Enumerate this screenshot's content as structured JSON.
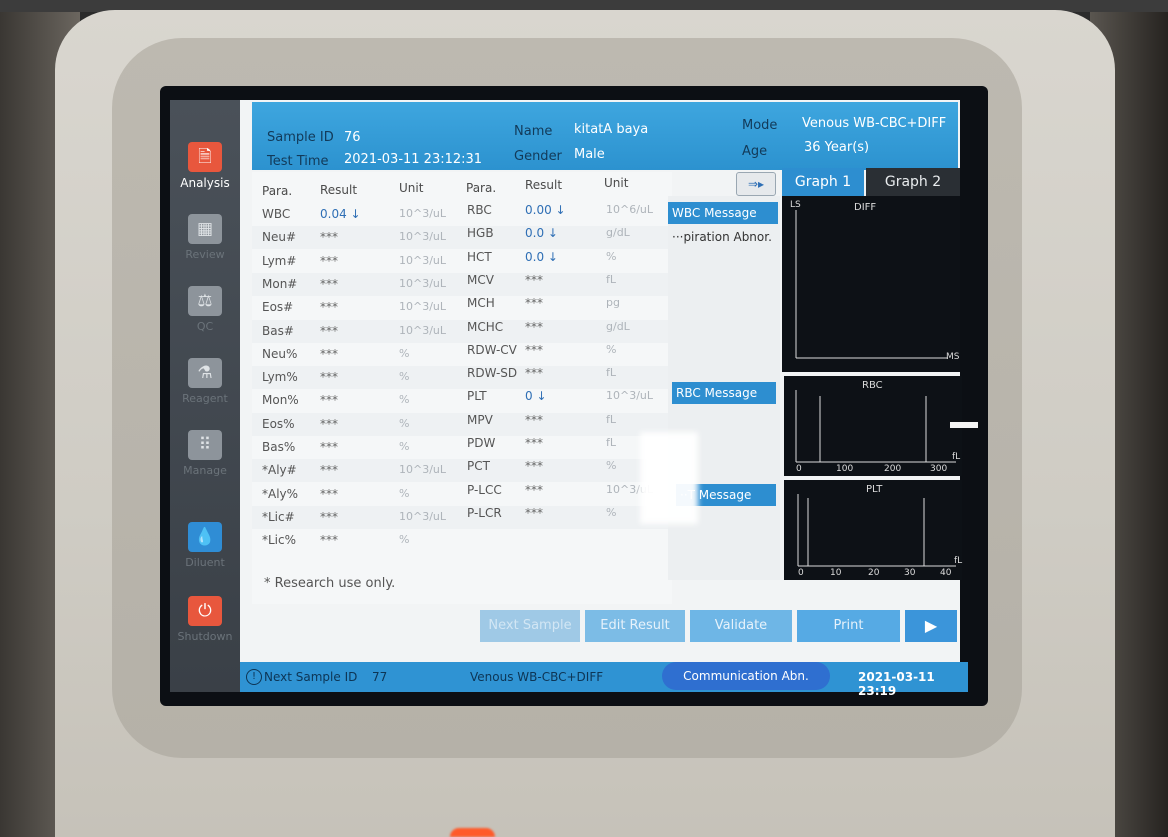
{
  "colors": {
    "header_blue": "#3ea6df",
    "accent_red": "#e8573d",
    "button_blue": "#5aaee6",
    "footer_pill": "#2f6fd0"
  },
  "sidebar": {
    "items": [
      {
        "label": "Analysis",
        "icon": "analysis-icon"
      },
      {
        "label": "Review",
        "icon": "review-icon"
      },
      {
        "label": "QC",
        "icon": "qc-balance-icon"
      },
      {
        "label": "Reagent",
        "icon": "reagent-icon"
      },
      {
        "label": "Manage",
        "icon": "manage-grid-icon"
      },
      {
        "label": "Diluent",
        "icon": "diluent-drop-icon"
      },
      {
        "label": "Shutdown",
        "icon": "power-icon"
      }
    ]
  },
  "header": {
    "sample_id_label": "Sample ID",
    "sample_id": "76",
    "test_time_label": "Test Time",
    "test_time": "2021-03-11 23:12:31",
    "name_label": "Name",
    "name": "kitatA baya",
    "gender_label": "Gender",
    "gender": "Male",
    "mode_label": "Mode",
    "mode": "Venous WB-CBC+DIFF",
    "age_label": "Age",
    "age": "36 Year(s)"
  },
  "table": {
    "headers": {
      "para": "Para.",
      "result": "Result",
      "unit": "Unit"
    },
    "left": [
      {
        "para": "WBC",
        "result": "0.04 ↓",
        "unit": "10^3/uL"
      },
      {
        "para": "Neu#",
        "result": "***",
        "unit": "10^3/uL"
      },
      {
        "para": "Lym#",
        "result": "***",
        "unit": "10^3/uL"
      },
      {
        "para": "Mon#",
        "result": "***",
        "unit": "10^3/uL"
      },
      {
        "para": "Eos#",
        "result": "***",
        "unit": "10^3/uL"
      },
      {
        "para": "Bas#",
        "result": "***",
        "unit": "10^3/uL"
      },
      {
        "para": "Neu%",
        "result": "***",
        "unit": "%"
      },
      {
        "para": "Lym%",
        "result": "***",
        "unit": "%"
      },
      {
        "para": "Mon%",
        "result": "***",
        "unit": "%"
      },
      {
        "para": "Eos%",
        "result": "***",
        "unit": "%"
      },
      {
        "para": "Bas%",
        "result": "***",
        "unit": "%"
      },
      {
        "para": "*Aly#",
        "result": "***",
        "unit": "10^3/uL"
      },
      {
        "para": "*Aly%",
        "result": "***",
        "unit": "%"
      },
      {
        "para": "*Lic#",
        "result": "***",
        "unit": "10^3/uL"
      },
      {
        "para": "*Lic%",
        "result": "***",
        "unit": "%"
      }
    ],
    "right": [
      {
        "para": "RBC",
        "result": "0.00 ↓",
        "unit": "10^6/uL"
      },
      {
        "para": "HGB",
        "result": "0.0 ↓",
        "unit": "g/dL"
      },
      {
        "para": "HCT",
        "result": "0.0 ↓",
        "unit": "%"
      },
      {
        "para": "MCV",
        "result": "***",
        "unit": "fL"
      },
      {
        "para": "MCH",
        "result": "***",
        "unit": "pg"
      },
      {
        "para": "MCHC",
        "result": "***",
        "unit": "g/dL"
      },
      {
        "para": "RDW-CV",
        "result": "***",
        "unit": "%"
      },
      {
        "para": "RDW-SD",
        "result": "***",
        "unit": "fL"
      },
      {
        "para": "PLT",
        "result": "0 ↓",
        "unit": "10^3/uL"
      },
      {
        "para": "MPV",
        "result": "***",
        "unit": "fL"
      },
      {
        "para": "PDW",
        "result": "***",
        "unit": "fL"
      },
      {
        "para": "PCT",
        "result": "***",
        "unit": "%"
      },
      {
        "para": "P-LCC",
        "result": "***",
        "unit": "10^3/uL"
      },
      {
        "para": "P-LCR",
        "result": "***",
        "unit": "%"
      }
    ],
    "research_note": "* Research use only."
  },
  "messages": {
    "wbc_title": "WBC Message",
    "wbc_text": "···piration Abnor.",
    "rbc_title": "RBC Message",
    "plt_title": "··T Message"
  },
  "graphs": {
    "tab1": "Graph 1",
    "tab2": "Graph 2",
    "diff": {
      "title": "DIFF",
      "y": "LS",
      "x": "MS"
    },
    "rbc": {
      "title": "RBC",
      "unit": "fL",
      "ticks": [
        "0",
        "100",
        "200",
        "300"
      ]
    },
    "plt": {
      "title": "PLT",
      "unit": "fL",
      "ticks": [
        "0",
        "10",
        "20",
        "30",
        "40"
      ]
    }
  },
  "buttons": {
    "next_sample": "Next Sample",
    "edit_result": "Edit Result",
    "validate": "Validate",
    "print": "Print",
    "more": "▶"
  },
  "footer": {
    "next_sample_label": "Next Sample ID",
    "next_sample_id": "77",
    "mode": "Venous WB-CBC+DIFF",
    "status": "Communication Abn.",
    "datetime": "2021-03-11 23:19"
  }
}
